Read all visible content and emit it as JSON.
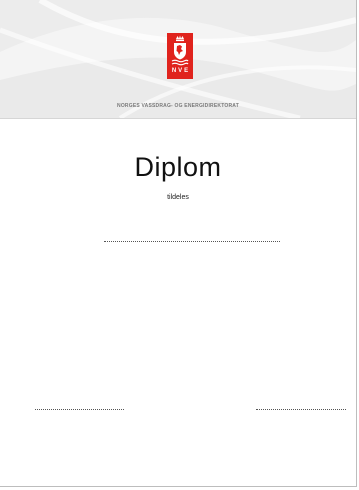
{
  "header": {
    "logo_text": "NVE",
    "agency_name": "NORGES VASSDRAG- OG ENERGIDIREKTORAT",
    "colors": {
      "logo_red": "#e0231d",
      "header_bg": "#f4f4f4"
    }
  },
  "certificate": {
    "title": "Diplom",
    "subtitle": "tildeles"
  }
}
